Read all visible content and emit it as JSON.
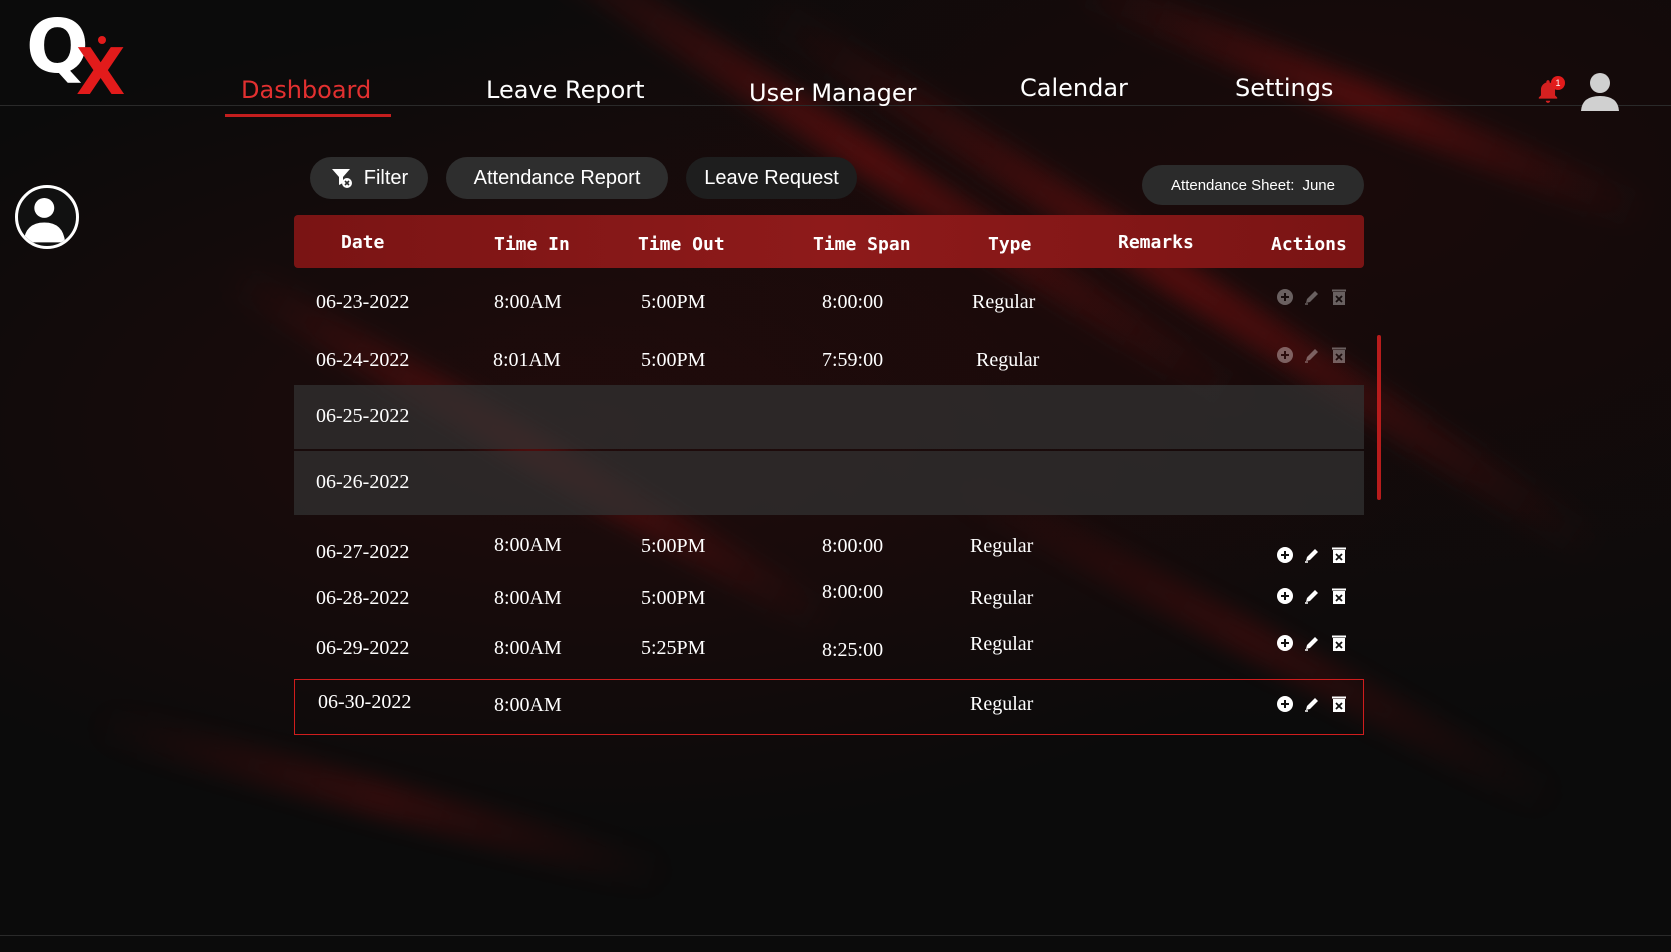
{
  "brand": {
    "logo_q": "Q",
    "logo_x": "X"
  },
  "nav": {
    "items": [
      {
        "label": "Dashboard",
        "active": true
      },
      {
        "label": "Leave Report",
        "active": false
      },
      {
        "label": "User Manager",
        "active": false
      },
      {
        "label": "Calendar",
        "active": false
      },
      {
        "label": "Settings",
        "active": false
      }
    ]
  },
  "notifications": {
    "count": "1"
  },
  "toolbar": {
    "filter_label": "Filter",
    "attendance_report_label": "Attendance Report",
    "leave_request_label": "Leave Request",
    "sheet_label": "Attendance Sheet:",
    "sheet_month": "June"
  },
  "table": {
    "headers": [
      "Date",
      "Time In",
      "Time Out",
      "Time Span",
      "Type",
      "Remarks",
      "Actions"
    ],
    "rows": [
      {
        "date": "06-23-2022",
        "time_in": "8:00AM",
        "time_out": "5:00PM",
        "span": "8:00:00",
        "type": "Regular",
        "remarks": "",
        "actions_enabled": false
      },
      {
        "date": "06-24-2022",
        "time_in": "8:01AM",
        "time_out": "5:00PM",
        "span": "7:59:00",
        "type": "Regular",
        "remarks": "",
        "actions_enabled": false
      },
      {
        "date": "06-25-2022",
        "time_in": "",
        "time_out": "",
        "span": "",
        "type": "",
        "remarks": "",
        "weekend": true
      },
      {
        "date": "06-26-2022",
        "time_in": "",
        "time_out": "",
        "span": "",
        "type": "",
        "remarks": "",
        "weekend": true
      },
      {
        "date": "06-27-2022",
        "time_in": "8:00AM",
        "time_out": "5:00PM",
        "span": "8:00:00",
        "type": "Regular",
        "remarks": "",
        "actions_enabled": true
      },
      {
        "date": "06-28-2022",
        "time_in": "8:00AM",
        "time_out": "5:00PM",
        "span": "8:00:00",
        "type": "Regular",
        "remarks": "",
        "actions_enabled": true
      },
      {
        "date": "06-29-2022",
        "time_in": "8:00AM",
        "time_out": "5:25PM",
        "span": "8:25:00",
        "type": "Regular",
        "remarks": "",
        "actions_enabled": true
      },
      {
        "date": "06-30-2022",
        "time_in": "8:00AM",
        "time_out": "",
        "span": "",
        "type": "Regular",
        "remarks": "",
        "actions_enabled": true,
        "selected": true
      }
    ]
  },
  "colors": {
    "accent": "#e21b1b",
    "header": "#8e1a1a",
    "background": "#0b0b0b"
  }
}
